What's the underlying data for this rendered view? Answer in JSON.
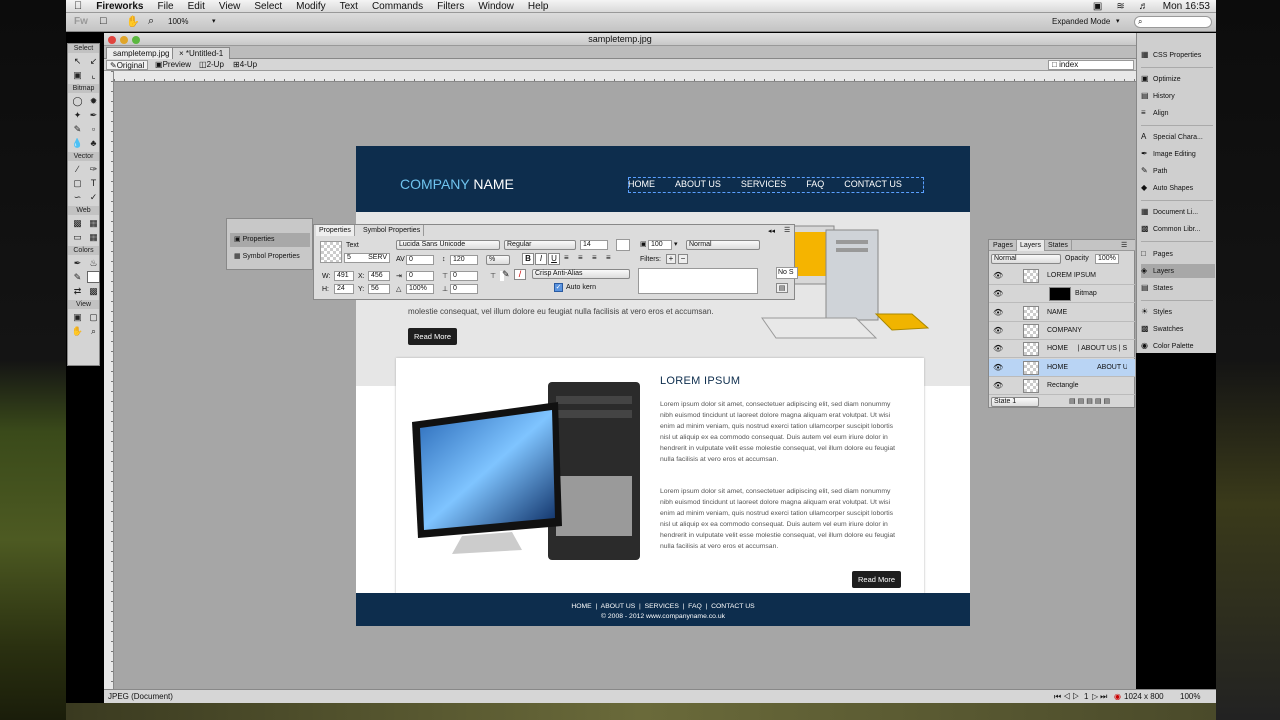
{
  "menubar": {
    "apple": "",
    "app": "Fireworks",
    "items": [
      "File",
      "Edit",
      "View",
      "Select",
      "Modify",
      "Text",
      "Commands",
      "Filters",
      "Window",
      "Help"
    ],
    "clock": "Mon 16:53"
  },
  "apptoolbar": {
    "logo": "Fw",
    "zoom": "100%",
    "workspace": "Expanded Mode"
  },
  "window": {
    "title": "sampletemp.jpg",
    "tabs": [
      "sampletemp.jpg",
      "*Untitled-1"
    ],
    "views": [
      "Original",
      "Preview",
      "2-Up",
      "4-Up"
    ],
    "page_name": "index"
  },
  "tools": {
    "sections": [
      "Select",
      "Bitmap",
      "Vector",
      "Web",
      "Colors",
      "View"
    ]
  },
  "webpage": {
    "logo_company": "COMPANY",
    "logo_name": "NAME",
    "nav": [
      "HOME",
      "ABOUT US",
      "SERVICES",
      "FAQ",
      "CONTACT US"
    ],
    "hero_text": "molestie consequat, vel illum dolore eu feugiat nulla facilisis at vero eros et accumsan.",
    "hero_button": "Read More",
    "card_title": "LOREM IPSUM",
    "para1": "Lorem ipsum dolor sit amet, consectetuer adipiscing elit, sed diam nonummy nibh euismod tincidunt ut laoreet dolore magna aliquam erat volutpat. Ut wisi enim ad minim veniam, quis nostrud exerci tation ullamcorper suscipit lobortis nisl ut aliquip ex ea commodo consequat. Duis autem vel eum iriure dolor in hendrerit in vulputate velit esse molestie consequat, vel illum dolore eu feugiat nulla facilisis at vero eros et accumsan.",
    "para2": "Lorem ipsum dolor sit amet, consectetuer adipiscing elit, sed diam nonummy nibh euismod tincidunt ut laoreet dolore magna aliquam erat volutpat. Ut wisi enim ad minim veniam, quis nostrud exerci tation ullamcorper suscipit lobortis nisl ut aliquip ex ea commodo consequat. Duis autem vel eum iriure dolor in hendrerit in vulputate velit esse molestie consequat, vel illum dolore eu feugiat nulla facilisis at vero eros et accumsan.",
    "card_button": "Read More",
    "footer_links": "HOME  |  ABOUT US  |  SERVICES  |  FAQ  |  CONTACT US",
    "footer_copy": "© 2008 - 2012 www.companyname.co.uk"
  },
  "properties": {
    "side_items": [
      "Properties",
      "Symbol Properties"
    ],
    "tabs": [
      "Properties",
      "Symbol Properties"
    ],
    "type_label": "Text",
    "object_name": "5",
    "object_name_suffix": "SERV",
    "w_label": "W:",
    "w": "491",
    "h_label": "H:",
    "h": "24",
    "x_label": "X:",
    "x": "456",
    "y_label": "Y:",
    "y": "56",
    "font": "Lucida Sans Unicode",
    "style": "Regular",
    "size": "14",
    "kerning": "0",
    "leading": "120",
    "leading_unit": "%",
    "indent": "0",
    "space_before": "0",
    "space_after": "0",
    "baseline": "0",
    "scale": "100%",
    "anti_alias": "Crisp Anti-Alias",
    "auto_kern": "Auto kern",
    "opacity": "100",
    "blend": "Normal",
    "filters_label": "Filters:",
    "no_style": "No S"
  },
  "layers": {
    "tabs": [
      "Pages",
      "Layers",
      "States"
    ],
    "blend": "Normal",
    "opacity_label": "Opacity",
    "opacity": "100%",
    "items": [
      "LOREM IPSUM",
      "Bitmap",
      "NAME",
      "COMPANY",
      "HOME     | ABOUT US | S",
      "HOME",
      "Rectangle"
    ],
    "selected_extra": "ABOUT U",
    "state": "State 1"
  },
  "dock": {
    "items": [
      "CSS Properties",
      "Optimize",
      "History",
      "Align",
      "Special Chara...",
      "Image Editing",
      "Path",
      "Auto Shapes",
      "Document Li...",
      "Common Libr...",
      "Pages",
      "Layers",
      "States",
      "Styles",
      "Swatches",
      "Color Palette"
    ]
  },
  "status": {
    "left": "JPEG (Document)",
    "page": "1",
    "size": "1024 x 800",
    "zoom": "100%"
  },
  "colors": {
    "brand": "#0d2d4d",
    "accent": "#6fc3ee"
  }
}
